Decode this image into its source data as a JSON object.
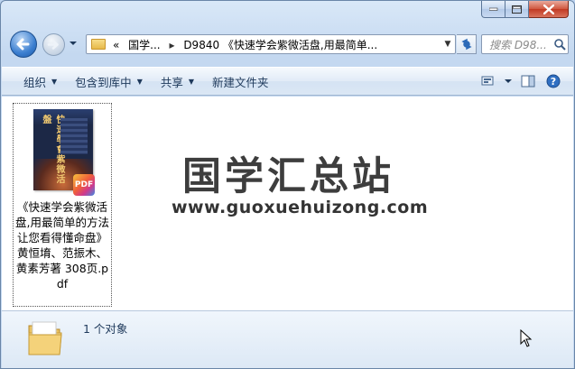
{
  "window": {
    "caption_buttons": [
      "minimize",
      "maximize",
      "close"
    ]
  },
  "nav": {
    "address_segments": [
      "«",
      "国学...",
      "▸",
      "D9840 《快速学会紫微活盘,用最简单..."
    ],
    "search_placeholder": "搜索 D98..."
  },
  "toolbar": {
    "organize": "组织",
    "include_library": "包含到库中",
    "share": "共享",
    "new_folder": "新建文件夹"
  },
  "content": {
    "file": {
      "name": "《快速学会紫微活盘,用最简单的方法让您看得懂命盘》黄恒堉、范振木、黄素芳著 308页.pdf",
      "badge": "PDF",
      "cover_text": "快速學會紫微活盤"
    },
    "watermark": {
      "title": "国学汇总站",
      "url": "www.guoxuehuizong.com"
    }
  },
  "details": {
    "count_text": "1 个对象"
  },
  "colors": {
    "accent": "#1e395b",
    "window_frame": "#c4d8f0",
    "close_red": "#c13a23"
  }
}
